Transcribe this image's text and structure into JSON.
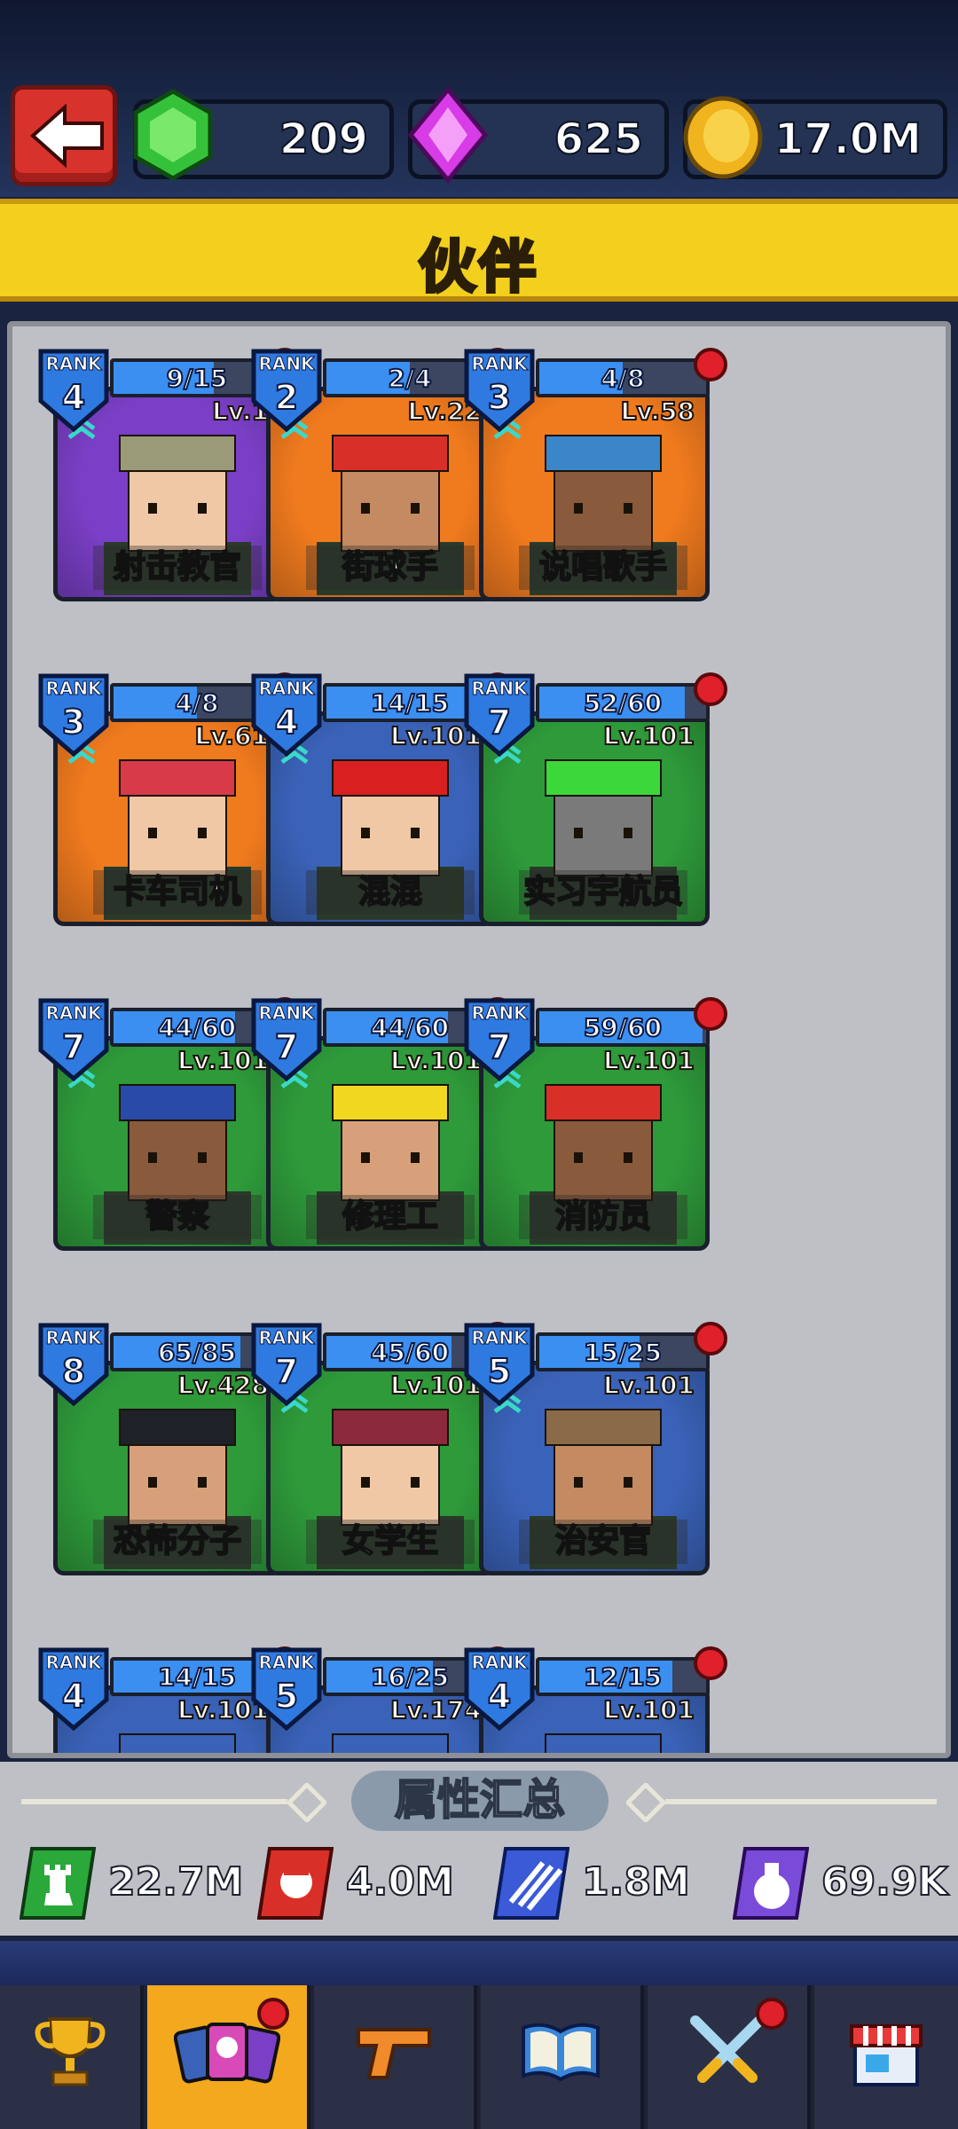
{
  "header": {
    "back_label": "back",
    "currencies": [
      {
        "name": "green-gem",
        "value": "209",
        "color": "#35c23a"
      },
      {
        "name": "purple-gem",
        "value": "625",
        "color": "#d73ce6"
      },
      {
        "name": "gold-coin",
        "value": "17.0M",
        "color": "#f0b41e"
      }
    ],
    "title": "伙伴"
  },
  "cards": [
    {
      "rank_label": "RANK",
      "rank": "4",
      "progress": "9/15",
      "fill": 0.6,
      "level": "Lv.1",
      "name": "射击教官",
      "bg": "#7a3fc6",
      "dot": true,
      "chevron": true,
      "skin": "#f0c8a6",
      "hat": "#9a9a78"
    },
    {
      "rank_label": "RANK",
      "rank": "2",
      "progress": "2/4",
      "fill": 0.5,
      "level": "Lv.22",
      "name": "街球手",
      "bg": "#f07a1e",
      "dot": true,
      "chevron": true,
      "skin": "#c48a62",
      "hat": "#d83028"
    },
    {
      "rank_label": "RANK",
      "rank": "3",
      "progress": "4/8",
      "fill": 0.5,
      "level": "Lv.58",
      "name": "说唱歌手",
      "bg": "#f07a1e",
      "dot": true,
      "chevron": true,
      "skin": "#8a5a3c",
      "hat": "#3a86c8"
    },
    {
      "rank_label": "RANK",
      "rank": "3",
      "progress": "4/8",
      "fill": 0.5,
      "level": "Lv.61",
      "name": "卡车司机",
      "bg": "#f07a1e",
      "dot": true,
      "chevron": true,
      "skin": "#f0c8a6",
      "hat": "#d83a4a"
    },
    {
      "rank_label": "RANK",
      "rank": "4",
      "progress": "14/15",
      "fill": 0.93,
      "level": "Lv.101",
      "name": "混混",
      "bg": "#3a62b8",
      "dot": true,
      "chevron": true,
      "skin": "#f0c8a6",
      "hat": "#d82020"
    },
    {
      "rank_label": "RANK",
      "rank": "7",
      "progress": "52/60",
      "fill": 0.87,
      "level": "Lv.101",
      "name": "实习宇航员",
      "bg": "#2e9a3a",
      "dot": true,
      "chevron": true,
      "skin": "#7a7a7a",
      "hat": "#3cd83a"
    },
    {
      "rank_label": "RANK",
      "rank": "7",
      "progress": "44/60",
      "fill": 0.73,
      "level": "Lv.101",
      "name": "警察",
      "bg": "#2e9a3a",
      "dot": true,
      "chevron": true,
      "skin": "#8a5a3c",
      "hat": "#2a4aa8"
    },
    {
      "rank_label": "RANK",
      "rank": "7",
      "progress": "44/60",
      "fill": 0.73,
      "level": "Lv.101",
      "name": "修理工",
      "bg": "#2e9a3a",
      "dot": true,
      "chevron": true,
      "skin": "#d8a07a",
      "hat": "#f0d820"
    },
    {
      "rank_label": "RANK",
      "rank": "7",
      "progress": "59/60",
      "fill": 0.98,
      "level": "Lv.101",
      "name": "消防员",
      "bg": "#2e9a3a",
      "dot": true,
      "chevron": true,
      "skin": "#8a5a3c",
      "hat": "#d83028"
    },
    {
      "rank_label": "RANK",
      "rank": "8",
      "progress": "65/85",
      "fill": 0.76,
      "level": "Lv.428",
      "name": "恐怖分子",
      "bg": "#2e9a3a",
      "dot": false,
      "chevron": false,
      "skin": "#d8a07a",
      "hat": "#1e2228"
    },
    {
      "rank_label": "RANK",
      "rank": "7",
      "progress": "45/60",
      "fill": 0.75,
      "level": "Lv.101",
      "name": "女学生",
      "bg": "#2e9a3a",
      "dot": true,
      "chevron": true,
      "skin": "#f0c8a6",
      "hat": "#8a2a3a"
    },
    {
      "rank_label": "RANK",
      "rank": "5",
      "progress": "15/25",
      "fill": 0.6,
      "level": "Lv.101",
      "name": "治安官",
      "bg": "#3a62b8",
      "dot": true,
      "chevron": true,
      "skin": "#c48a62",
      "hat": "#8a6a48"
    },
    {
      "rank_label": "RANK",
      "rank": "4",
      "progress": "14/15",
      "fill": 0.93,
      "level": "Lv.101",
      "name": "",
      "bg": "#3a62b8",
      "dot": true,
      "chevron": false,
      "skin": "#f0c8a6",
      "hat": "#3a62b8"
    },
    {
      "rank_label": "RANK",
      "rank": "5",
      "progress": "16/25",
      "fill": 0.64,
      "level": "Lv.174",
      "name": "",
      "bg": "#3a62b8",
      "dot": true,
      "chevron": false,
      "skin": "#f0c8a6",
      "hat": "#3a62b8"
    },
    {
      "rank_label": "RANK",
      "rank": "4",
      "progress": "12/15",
      "fill": 0.8,
      "level": "Lv.101",
      "name": "",
      "bg": "#3a62b8",
      "dot": true,
      "chevron": false,
      "skin": "#f0c8a6",
      "hat": "#3a62b8"
    }
  ],
  "summary": {
    "title": "属性汇总",
    "stats": [
      {
        "icon": "tower-icon",
        "value": "22.7M",
        "color": "#2aa83a"
      },
      {
        "icon": "fist-icon",
        "value": "4.0M",
        "color": "#d83028"
      },
      {
        "icon": "auto-bullets-icon",
        "value": "1.8M",
        "color": "#3a5ad8"
      },
      {
        "icon": "money-bag-icon",
        "value": "69.9K",
        "color": "#7a4ad8"
      }
    ]
  },
  "nav": {
    "tabs": [
      {
        "icon": "trophy-icon",
        "active": false,
        "dot": false
      },
      {
        "icon": "partner-cards-icon",
        "active": true,
        "dot": true
      },
      {
        "icon": "pistol-icon",
        "active": false,
        "dot": false
      },
      {
        "icon": "book-icon",
        "active": false,
        "dot": false
      },
      {
        "icon": "crossed-swords-icon",
        "active": false,
        "dot": true
      },
      {
        "icon": "shop-icon",
        "active": false,
        "dot": false
      }
    ]
  }
}
